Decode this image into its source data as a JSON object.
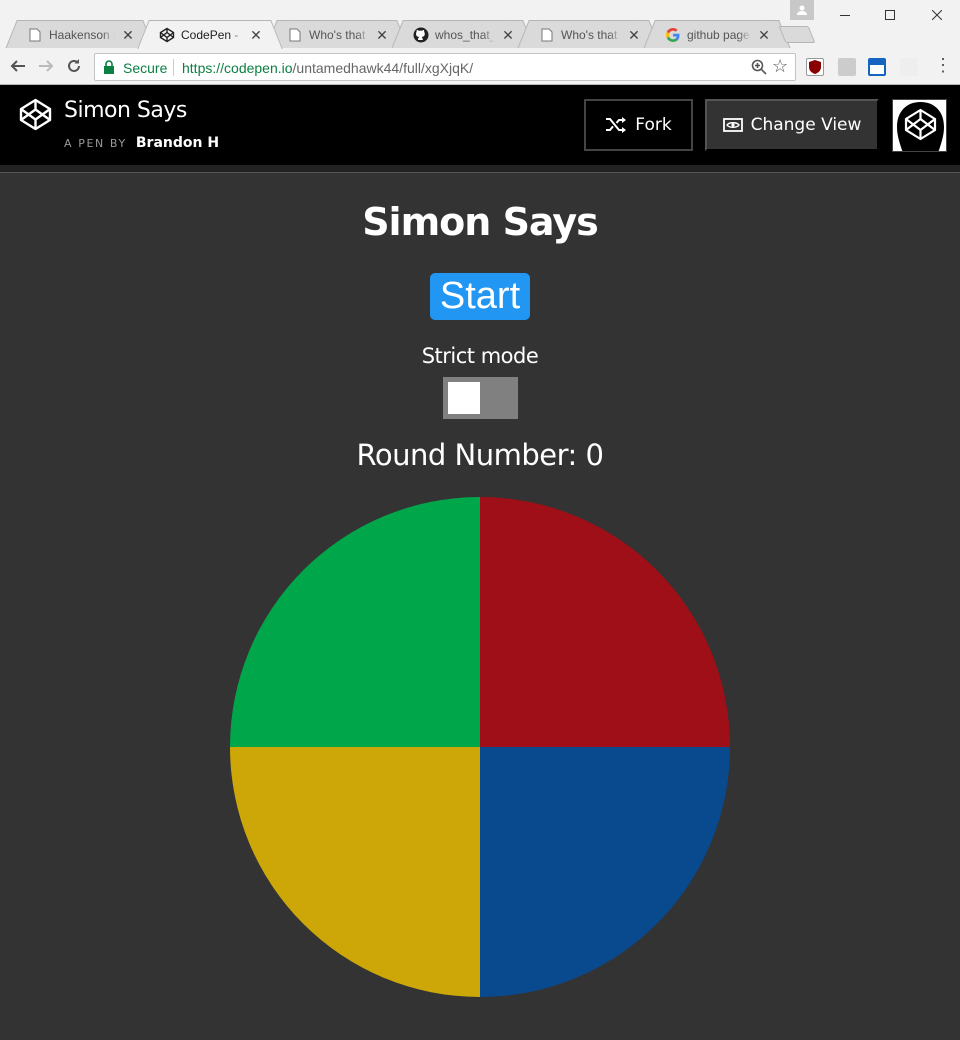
{
  "browser": {
    "tabs": [
      {
        "title": "Haakenson F",
        "favicon": "page-icon"
      },
      {
        "title": "CodePen - S",
        "favicon": "codepen-icon",
        "active": true
      },
      {
        "title": "Who's that F",
        "favicon": "page-icon"
      },
      {
        "title": "whos_that_p",
        "favicon": "github-icon"
      },
      {
        "title": "Who's that F",
        "favicon": "page-icon"
      },
      {
        "title": "github page",
        "favicon": "google-icon"
      }
    ],
    "secure_label": "Secure",
    "url_scheme": "https://",
    "url_host": "codepen.io",
    "url_path": "/untamedhawk44/full/xgXjqK/"
  },
  "header": {
    "pen_title": "Simon Says",
    "byline_prefix": "A PEN BY",
    "author": "Brandon H",
    "fork_label": "Fork",
    "change_view_label": "Change View"
  },
  "game": {
    "title": "Simon Says",
    "start_label": "Start",
    "strict_label": "Strict mode",
    "strict_enabled": false,
    "round_label": "Round Number: 0",
    "quadrants": [
      {
        "name": "green",
        "color": "#00a74a"
      },
      {
        "name": "red",
        "color": "#9f0f17"
      },
      {
        "name": "yellow",
        "color": "#cca707"
      },
      {
        "name": "blue",
        "color": "#094a8f"
      }
    ]
  }
}
